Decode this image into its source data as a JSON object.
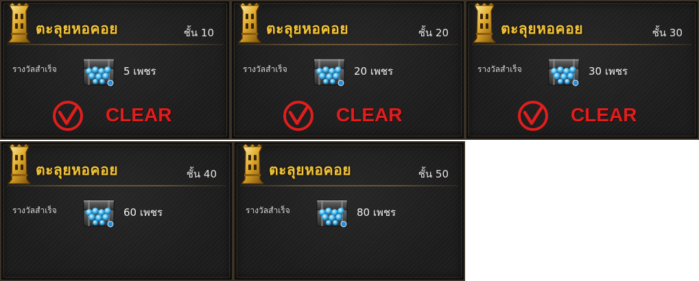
{
  "colors": {
    "title": "#f0c53c",
    "clear": "#e01e1e",
    "panel": "#1c1c1c",
    "border": "#3a3226"
  },
  "icons": {
    "tower": "gold-tower-icon",
    "chest": "diamond-chest-icon",
    "check": "red-check-circle-icon"
  },
  "cards": [
    {
      "title": "ตะลุยหอคอย",
      "floor": "ชั้น 10",
      "reward_label": "รางวัลสำเร็จ",
      "reward": "5 เพชร",
      "status": "CLEAR"
    },
    {
      "title": "ตะลุยหอคอย",
      "floor": "ชั้น 20",
      "reward_label": "รางวัลสำเร็จ",
      "reward": "20 เพชร",
      "status": "CLEAR"
    },
    {
      "title": "ตะลุยหอคอย",
      "floor": "ชั้น 30",
      "reward_label": "รางวัลสำเร็จ",
      "reward": "30 เพชร",
      "status": "CLEAR"
    },
    {
      "title": "ตะลุยหอคอย",
      "floor": "ชั้น 40",
      "reward_label": "รางวัลสำเร็จ",
      "reward": "60 เพชร"
    },
    {
      "title": "ตะลุยหอคอย",
      "floor": "ชั้น 50",
      "reward_label": "รางวัลสำเร็จ",
      "reward": "80 เพชร"
    }
  ]
}
